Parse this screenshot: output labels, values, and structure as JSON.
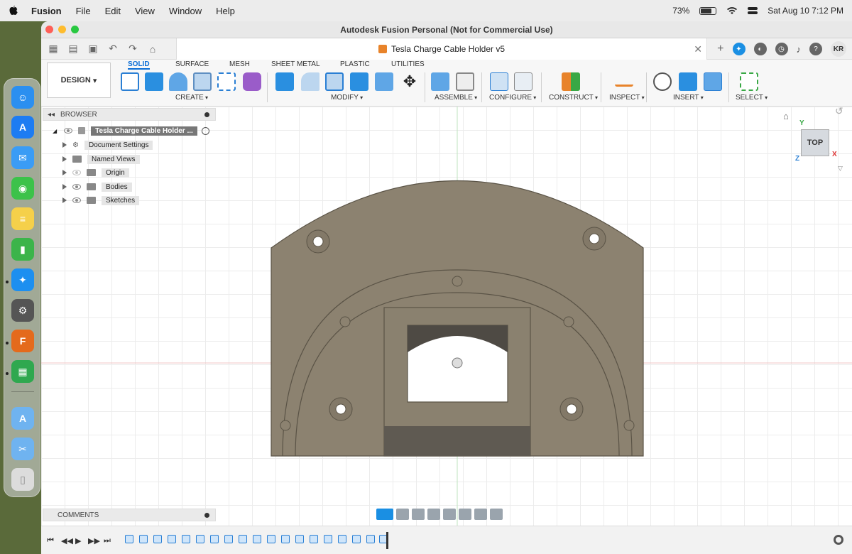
{
  "menubar": {
    "app": "Fusion",
    "items": [
      "File",
      "Edit",
      "View",
      "Window",
      "Help"
    ],
    "battery": "73%",
    "clock": "Sat Aug 10  7:12 PM"
  },
  "window": {
    "title": "Autodesk Fusion Personal (Not for Commercial Use)",
    "document_tab": "Tesla Charge Cable Holder v5",
    "close_glyph": "✕",
    "avatar": "KR"
  },
  "ribbon": {
    "workspace": "DESIGN",
    "tabs": [
      "SOLID",
      "SURFACE",
      "MESH",
      "SHEET METAL",
      "PLASTIC",
      "UTILITIES"
    ],
    "active_tab": "SOLID",
    "groups": [
      "CREATE",
      "MODIFY",
      "ASSEMBLE",
      "CONFIGURE",
      "CONSTRUCT",
      "INSPECT",
      "INSERT",
      "SELECT"
    ]
  },
  "browser": {
    "title": "BROWSER",
    "root": "Tesla Charge Cable Holder ...",
    "items": [
      "Document Settings",
      "Named Views",
      "Origin",
      "Bodies",
      "Sketches"
    ]
  },
  "comments": {
    "title": "COMMENTS"
  },
  "viewcube": {
    "face": "TOP",
    "axes": [
      "Y",
      "X",
      "Z"
    ]
  },
  "colors": {
    "accent": "#0a6dd6",
    "part": "#8c8270",
    "part_dark": "#6e6658"
  }
}
